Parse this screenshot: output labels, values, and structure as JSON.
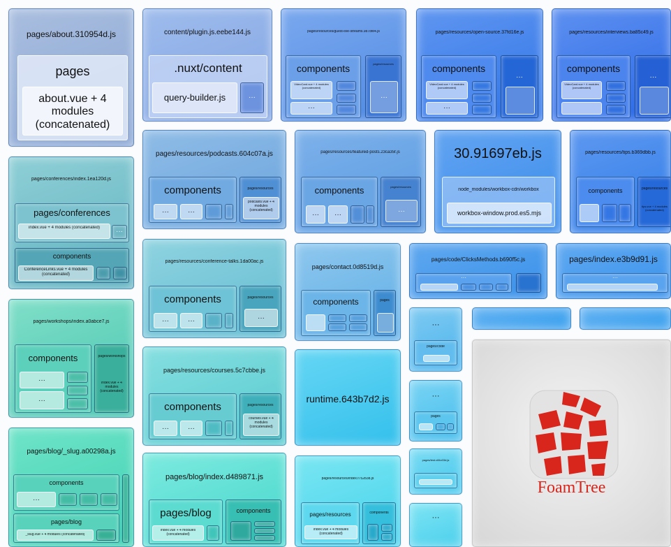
{
  "tiles": {
    "about": {
      "name": "pages/about.310954d.js",
      "group": "pages",
      "module": "about.vue + 4 modules (concatenated)"
    },
    "plugin": {
      "name": "content/plugin.js.eebe144.js",
      "group": ".nuxt/content",
      "module": "query-builder.js",
      "more": "···"
    },
    "guest": {
      "name": "pages/resources/guest-live-streams.9878fe4.js",
      "components": "components",
      "sub": "VideoCard.vue + 4 modules (concatenated)",
      "side": "pages/resources",
      "more": "···"
    },
    "opensource": {
      "name": "pages/resources/open-source.37fd16e.js",
      "components": "components",
      "sub": "VideoCard.vue + 4 modules (concatenated)",
      "more": "···"
    },
    "interviews": {
      "name": "pages/resources/interviews.ba85c49.js",
      "components": "components",
      "sub": "VideoCard.vue + 4 modules (concatenated)",
      "more": "···"
    },
    "conferences": {
      "name": "pages/conferences/index.1ea120d.js",
      "group": "pages/conferences",
      "module": "index.vue + 4 modules (concatenated)",
      "components": "components",
      "sub": "ConferenceLinks.vue + 4 modules (concatenated)",
      "more": "···"
    },
    "podcasts": {
      "name": "pages/resources/podcasts.604c07a.js",
      "components": "components",
      "side": "pages/resources",
      "sub": "podcasts.vue + 4 modules (concatenated)",
      "more": "···"
    },
    "featured": {
      "name": "pages/resources/featured-posts.23ca35f.js",
      "components": "components",
      "side": "pages/resources",
      "more": "···"
    },
    "workbox": {
      "name": "30.91697eb.js",
      "path": "node_modules/workbox-cdn/workbox",
      "module": "workbox-window.prod.es5.mjs"
    },
    "tips": {
      "name": "pages/resources/tips.b369dbb.js",
      "components": "components",
      "side": "pages/resources",
      "sub": "tips.vue + 4 modules (concatenated)"
    },
    "conftalks": {
      "name": "pages/resources/conference-talks.1da00ac.js",
      "components": "components",
      "side": "pages/resources",
      "more": "···"
    },
    "contact": {
      "name": "pages/contact.0d8519d.js",
      "components": "components",
      "side": "pages"
    },
    "clicks": {
      "name": "pages/code/ClicksMethods.b690f5c.js",
      "more": "···"
    },
    "index": {
      "name": "pages/index.e3b9d91.js",
      "more": "···"
    },
    "workshops": {
      "name": "pages/workshops/index.a0abce7.js",
      "components": "components",
      "side": "pages/workshops",
      "sub": "index.vue + 4 modules (concatenated)",
      "more": "···"
    },
    "courses": {
      "name": "pages/resources/courses.5c7cbbe.js",
      "components": "components",
      "side": "pages/resources",
      "sub": "courses.vue + 4 modules (concatenated)",
      "more": "···"
    },
    "runtime": {
      "name": "runtime.643b7d2.js"
    },
    "code": {
      "name": "···",
      "sub": "pages/code"
    },
    "pagesSmall": {
      "name": "···",
      "sub": "pages"
    },
    "testTile": {
      "name": "pages/test.c84c03d.js"
    },
    "misc": {
      "name": "···"
    },
    "slug": {
      "name": "pages/blog/_slug.a00298a.js",
      "components": "components",
      "group": "pages/blog",
      "sub": "_slug.vue + 4 modules (concatenated)",
      "more": "···"
    },
    "blog": {
      "name": "pages/blog/index.d489871.js",
      "group": "pages/blog",
      "module": "index.vue + 4 modules (concatenated)",
      "components": "components"
    },
    "resindex": {
      "name": "pages/resources/index.f752b3b.js",
      "group": "pages/resources",
      "module": "index.vue + 4 modules (concatenated)",
      "components": "components"
    }
  },
  "logo": {
    "text": "FoamTree"
  },
  "colors": {
    "accent": "#d9261c",
    "blue": "#3d7be8",
    "teal": "#3cc6c0",
    "cyan": "#48d6ee"
  }
}
